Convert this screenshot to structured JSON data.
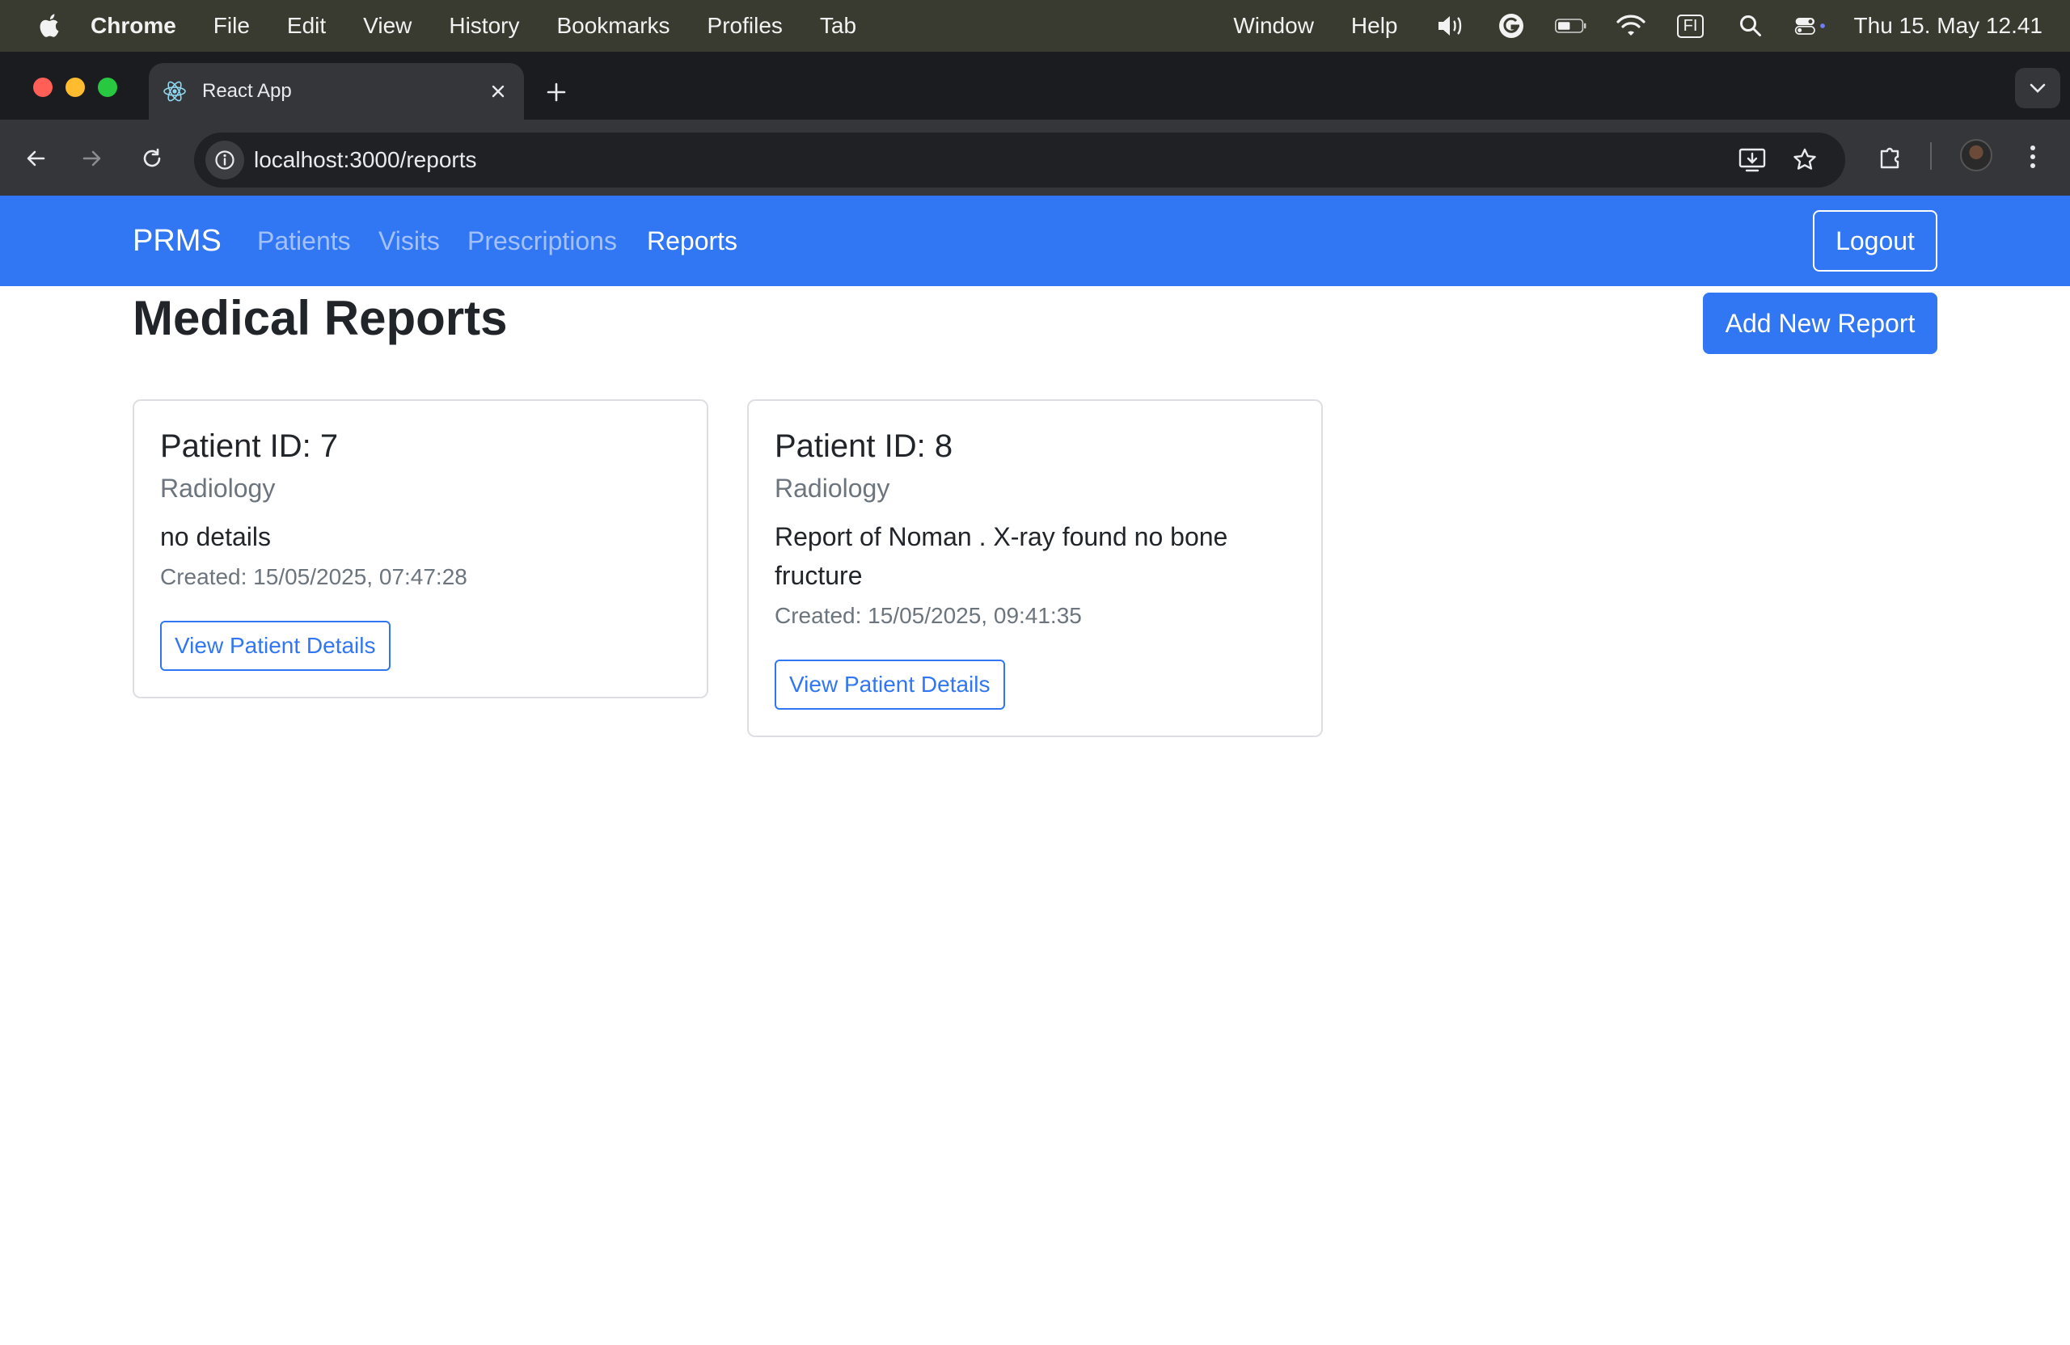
{
  "menubar": {
    "app_name": "Chrome",
    "items": [
      "File",
      "Edit",
      "View",
      "History",
      "Bookmarks",
      "Profiles",
      "Tab"
    ],
    "right_items": [
      "Window",
      "Help"
    ],
    "keyboard_label": "FI",
    "clock": "Thu 15. May  12.41"
  },
  "browser": {
    "tab_title": "React App",
    "url": "localhost:3000/reports"
  },
  "navbar": {
    "brand": "PRMS",
    "links": [
      {
        "label": "Patients",
        "active": false
      },
      {
        "label": "Visits",
        "active": false
      },
      {
        "label": "Prescriptions",
        "active": false
      },
      {
        "label": "Reports",
        "active": true
      }
    ],
    "logout_label": "Logout"
  },
  "page": {
    "title": "Medical Reports",
    "add_button_label": "Add New Report"
  },
  "reports": [
    {
      "patient": "Patient ID: 7",
      "type": "Radiology",
      "details": "no details",
      "created": "Created: 15/05/2025, 07:47:28",
      "button_label": "View Patient Details"
    },
    {
      "patient": "Patient ID: 8",
      "type": "Radiology",
      "details": "Report of Noman . X-ray found no bone fructure",
      "created": "Created: 15/05/2025, 09:41:35",
      "button_label": "View Patient Details"
    }
  ],
  "colors": {
    "primary": "#3176f3",
    "menubar_bg": "#3a3b30",
    "chrome_toolbar": "#34363a"
  }
}
